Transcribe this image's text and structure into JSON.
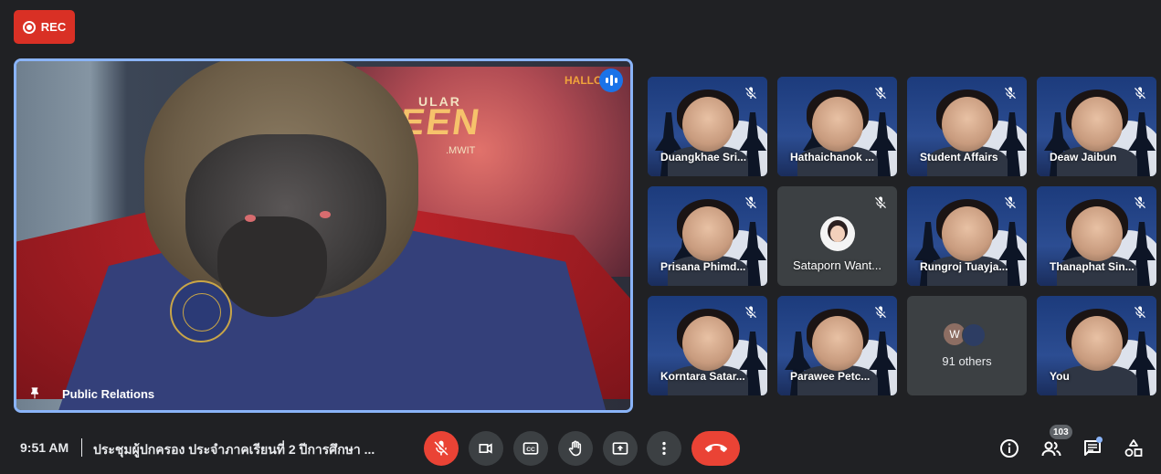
{
  "recording": {
    "label": "REC"
  },
  "main_tile": {
    "name": "Public Relations",
    "poster_line1": "ULAR",
    "poster_line2": "EEN",
    "poster_sub": ".MWIT",
    "poster_brand": "HALLOW"
  },
  "participants": [
    {
      "name": "Duangkhae Sri...",
      "muted": true
    },
    {
      "name": "Hathaichanok ...",
      "muted": true
    },
    {
      "name": "Student Affairs",
      "muted": true
    },
    {
      "name": "Deaw Jaibun",
      "muted": true
    },
    {
      "name": "Prisana Phimd...",
      "muted": true
    },
    {
      "name": "Sataporn Want...",
      "muted": true,
      "camera_off": true
    },
    {
      "name": "Rungroj Tuayja...",
      "muted": true
    },
    {
      "name": "Thanaphat Sin...",
      "muted": true
    },
    {
      "name": "Korntara Satar...",
      "muted": true
    },
    {
      "name": "Parawee Petc...",
      "muted": true
    },
    {
      "name": "You",
      "muted": true
    }
  ],
  "others": {
    "initial": "W",
    "label": "91 others"
  },
  "bottom_bar": {
    "time": "9:51 AM",
    "meeting_title": "ประชุมผู้ปกครอง ประจำภาคเรียนที่ 2 ปีการศึกษา ...",
    "participant_count": "103"
  },
  "colors": {
    "background": "#202124",
    "rec_red": "#d93025",
    "active_speaker_border": "#8ab4f8",
    "control_gray": "#3c4043",
    "danger_red": "#ea4335"
  },
  "icons": {
    "rec": "record-icon",
    "pin": "pin-icon",
    "speaking": "audio-level-icon",
    "mute": "mic-off-icon",
    "mic": "mic-off-icon",
    "camera": "videocam-icon",
    "captions": "closed-caption-icon",
    "hand": "raise-hand-icon",
    "present": "present-screen-icon",
    "more": "more-vert-icon",
    "end": "call-end-icon",
    "info": "info-icon",
    "people": "people-icon",
    "chat": "chat-icon",
    "activities": "activities-icon"
  }
}
